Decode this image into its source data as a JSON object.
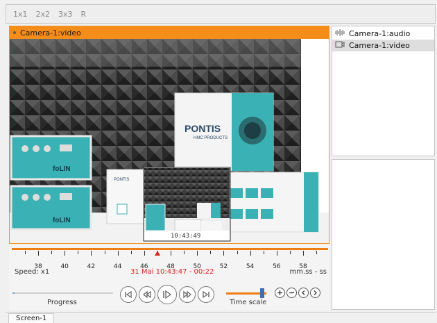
{
  "layout_bar": {
    "items": [
      "1x1",
      "2x2",
      "3x3",
      "R"
    ]
  },
  "video": {
    "title": "Camera-1:video",
    "overlay_brand": "PONTIS",
    "overlay_brand_sub": "HMC PRODUCTS",
    "overlay_device_label": "foLIN",
    "overlay_device_label_2": "foLIN",
    "overlay_small_brand": "PONTIS",
    "thumbnail_time": "10:43:49"
  },
  "sources": {
    "items": [
      {
        "label": "Camera-1:audio",
        "icon": "audio-waveform-icon",
        "selected": false
      },
      {
        "label": "Camera-1:video",
        "icon": "video-camera-icon",
        "selected": true
      }
    ]
  },
  "timeline": {
    "tick_labels": [
      "38",
      "40",
      "42",
      "44",
      "46",
      "48",
      "50",
      "52",
      "54",
      "56",
      "58"
    ],
    "speed": "Speed: x1",
    "current_time": "31 Mai 10:43:47 - 00:22",
    "format": "mm.ss - ss",
    "progress_label": "Progress",
    "progress_value": 0.02,
    "time_scale_label": "Time scale",
    "time_scale_value": 0.9,
    "marker_value": 47
  },
  "tabs": [
    "Screen-1"
  ],
  "colors": {
    "accent": "#f58d1a",
    "marker": "#d9251b",
    "time_text": "#e02020",
    "knob": "#3e6fb4"
  }
}
